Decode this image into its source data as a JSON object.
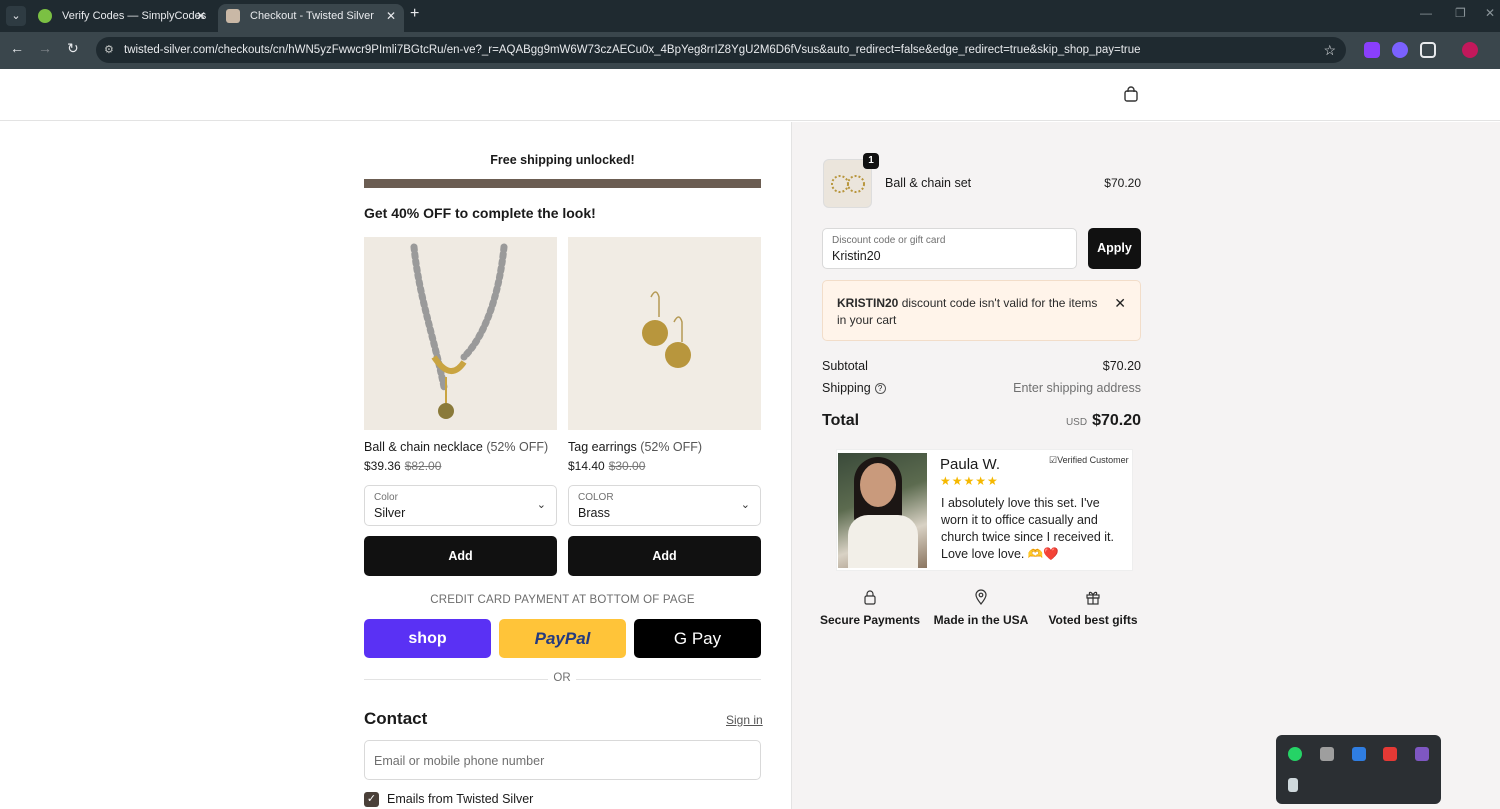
{
  "browser": {
    "tabs": [
      {
        "title": "Verify Codes — SimplyCodes",
        "active": false
      },
      {
        "title": "Checkout - Twisted Silver",
        "active": true
      }
    ],
    "url": "twisted-silver.com/checkouts/cn/hWN5yzFwwcr9PImli7BGtcRu/en-ve?_r=AQABgg9mW6W73czAECu0x_4BpYeg8rrIZ8YgU2M6D6fVsus&auto_redirect=false&edge_redirect=true&skip_shop_pay=true"
  },
  "checkout": {
    "free_shipping": "Free shipping unlocked!",
    "progress_fraction": 1.0,
    "upsell_title": "Get 40% OFF to complete the look!",
    "products": [
      {
        "name": "Ball & chain necklace",
        "discount": "(52% OFF)",
        "price": "$39.36",
        "original_price": "$82.00",
        "option_label": "Color",
        "option_value": "Silver",
        "add_label": "Add"
      },
      {
        "name": "Tag earrings",
        "discount": "(52% OFF)",
        "price": "$14.40",
        "original_price": "$30.00",
        "option_label": "COLOR",
        "option_value": "Brass",
        "add_label": "Add"
      }
    ],
    "cc_note": "CREDIT CARD PAYMENT AT BOTTOM OF PAGE",
    "pay": {
      "shop": "shop",
      "paypal": "PayPal",
      "gpay": "G Pay"
    },
    "or_text": "OR",
    "contact_title": "Contact",
    "sign_in": "Sign in",
    "email_placeholder": "Email or mobile phone number",
    "emails_opt_in": "Emails from Twisted Silver"
  },
  "summary": {
    "item": {
      "name": "Ball & chain set",
      "quantity": "1",
      "price": "$70.20"
    },
    "discount_label": "Discount code or gift card",
    "discount_value": "Kristin20",
    "apply_label": "Apply",
    "error_code": "KRISTIN20",
    "error_message": " discount code isn't valid for the items in your cart",
    "subtotal_label": "Subtotal",
    "subtotal_value": "$70.20",
    "shipping_label": "Shipping",
    "shipping_value": "Enter shipping address",
    "total_label": "Total",
    "total_currency": "USD",
    "total_value": "$70.20"
  },
  "review": {
    "name": "Paula W.",
    "verified": "Verified Customer",
    "stars": "★★★★★",
    "rating": 5,
    "text": "I absolutely love this set. I've worn it to office casually and church twice since I received it. Love love love. 🫶❤️"
  },
  "badges": [
    {
      "icon": "lock-icon",
      "label": "Secure Payments"
    },
    {
      "icon": "map-pin-icon",
      "label": "Made in the USA"
    },
    {
      "icon": "gift-icon",
      "label": "Voted best gifts"
    }
  ],
  "colors": {
    "primary_button": "#111111",
    "progress_fill": "#6b5d52",
    "shop_pay": "#5a31f4",
    "paypal": "#ffc439",
    "error_bg": "#fff4ea",
    "summary_bg": "#f5f3f3"
  }
}
